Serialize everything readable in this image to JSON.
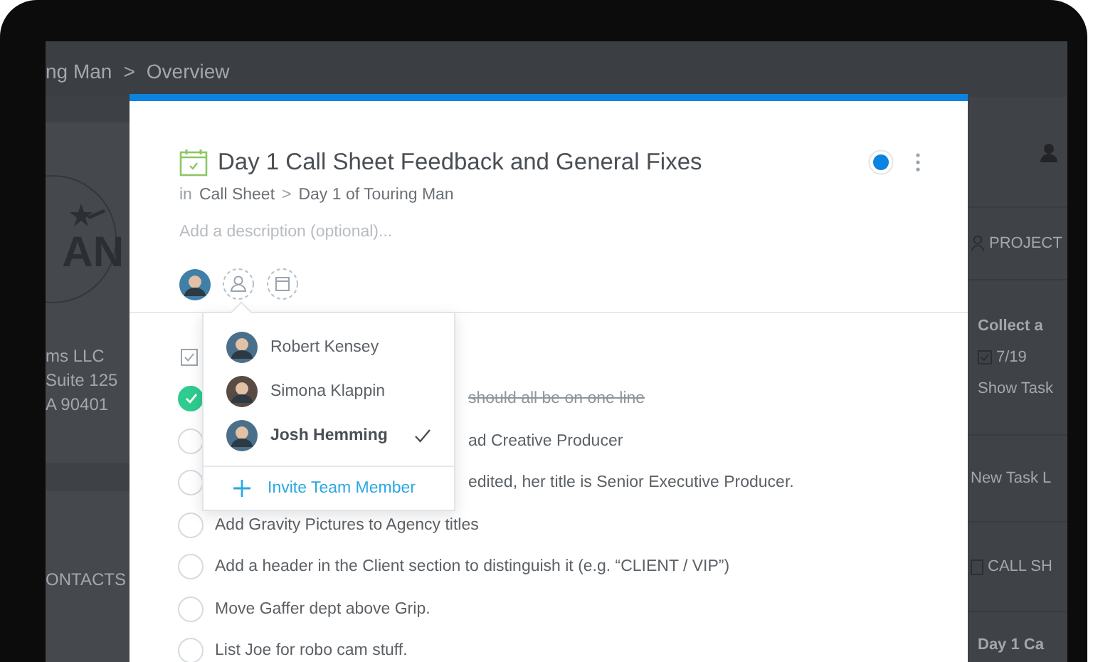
{
  "background": {
    "breadcrumb": {
      "items": [
        "ng Man",
        "Overview"
      ],
      "separator": ">"
    },
    "left_panel": {
      "logo_text": "AN",
      "address_lines": [
        "ms LLC",
        "Suite 125",
        "A 90401"
      ],
      "section_title": "ONTACTS"
    },
    "right_panel": {
      "project_label": "PROJECT",
      "task_list_title": "Collect a",
      "task_count": "7/19",
      "show_tasks": "Show Task",
      "new_task_list": "New Task L",
      "call_sheet_label": "CALL SH",
      "call_sheet_title": "Day 1 Ca"
    }
  },
  "task_modal": {
    "title": "Day 1 Call Sheet Feedback and General Fixes",
    "breadcrumb": {
      "prefix": "in",
      "items": [
        "Call Sheet",
        "Day 1 of Touring Man"
      ],
      "separator": ">"
    },
    "description": {
      "placeholder": "Add a description (optional)..."
    },
    "tasks": [
      {
        "text": "should all be on one line",
        "done": true,
        "partly_hidden": true
      },
      {
        "text": "ad Creative Producer",
        "done": false,
        "partly_hidden": true
      },
      {
        "text": "edited, her title is Senior Executive Producer.",
        "done": false,
        "partly_hidden": true
      },
      {
        "text": "Add Gravity Pictures to Agency titles",
        "done": false,
        "partly_hidden": false
      },
      {
        "text": "Add a header in the Client section to distinguish it (e.g. “CLIENT / VIP”)",
        "done": false,
        "partly_hidden": false
      },
      {
        "text": "Move Gaffer dept above Grip.",
        "done": false,
        "partly_hidden": false
      },
      {
        "text": "List Joe for robo cam stuff.",
        "done": false,
        "partly_hidden": false
      }
    ]
  },
  "assignee_menu": {
    "members": [
      {
        "name": "Robert Kensey",
        "selected": false
      },
      {
        "name": "Simona Klappin",
        "selected": false
      },
      {
        "name": "Josh Hemming",
        "selected": true
      }
    ],
    "invite_label": "Invite Team Member"
  }
}
